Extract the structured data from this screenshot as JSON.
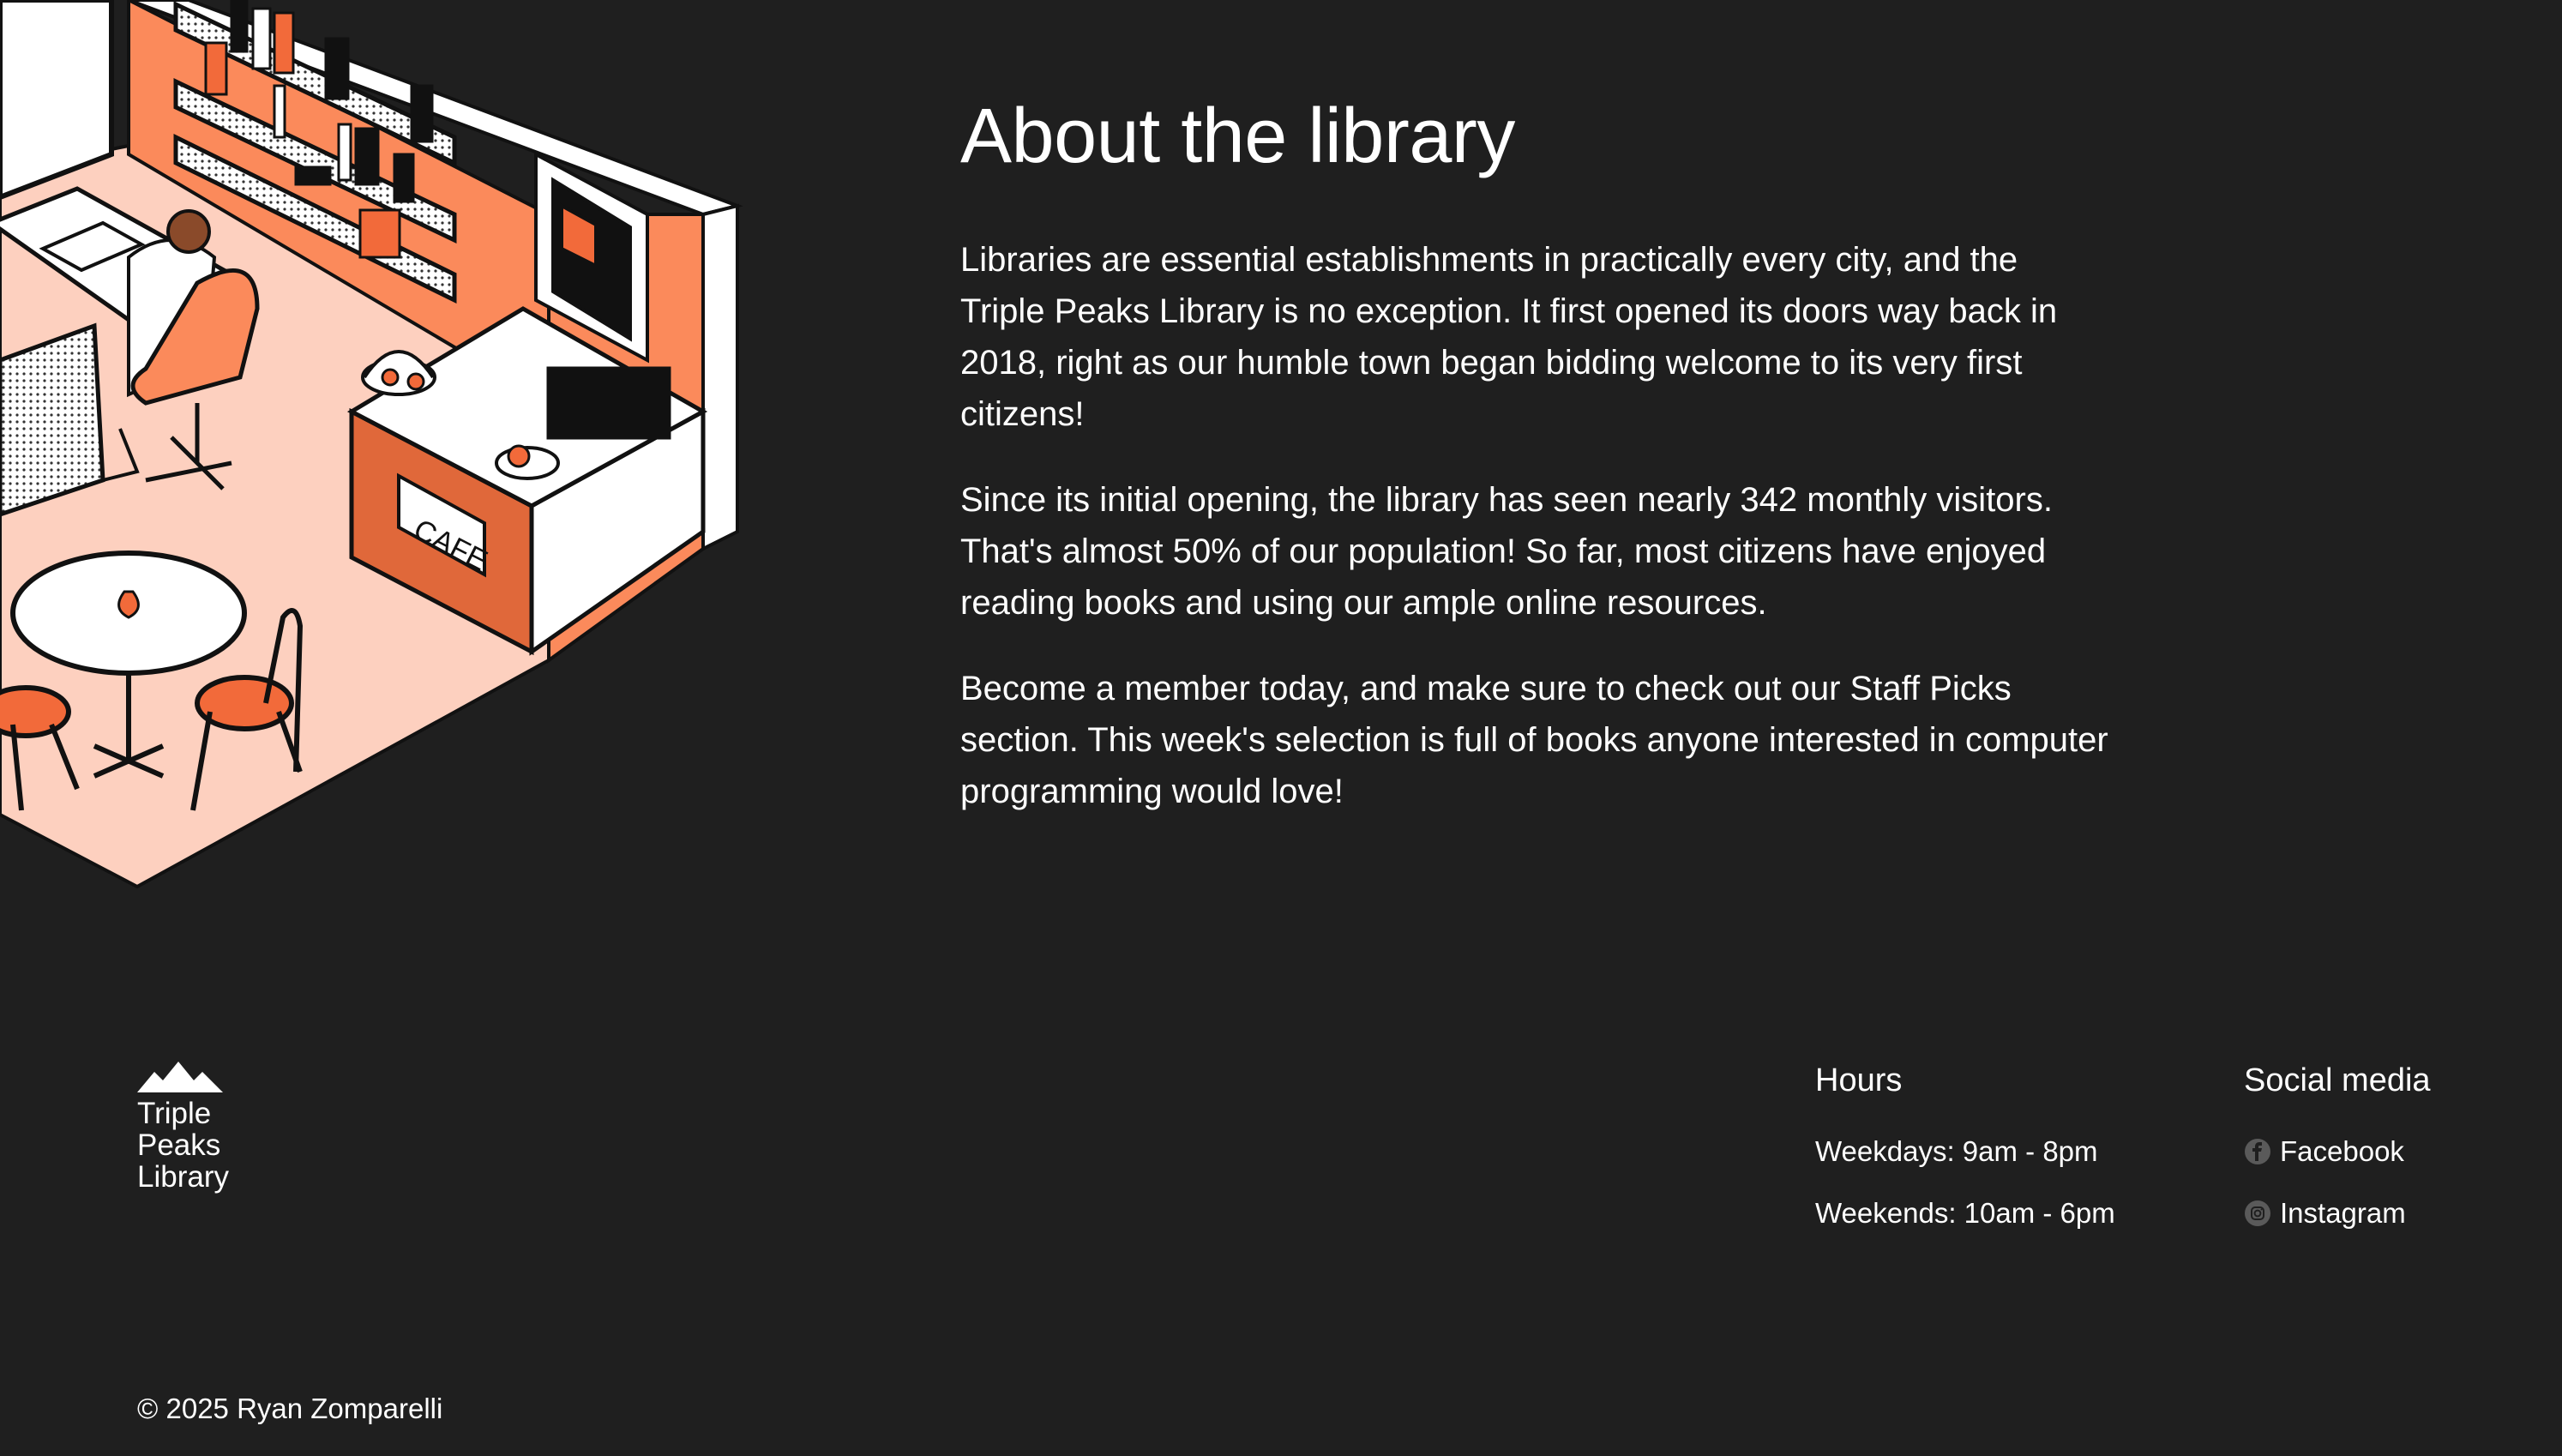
{
  "about": {
    "title": "About the library",
    "paragraphs": [
      "Libraries are essential establishments in practically every city, and the Triple Peaks Library is no exception. It first opened its doors way back in 2018, right as our humble town began bidding welcome to its very first citizens!",
      "Since its initial opening, the library has seen nearly 342 monthly visitors. That's almost 50% of our population! So far, most citizens have enjoyed reading books and using our ample online resources.",
      "Become a member today, and make sure to check out our Staff Picks section. This week's selection is full of books anyone interested in computer programming would love!"
    ]
  },
  "illustration": {
    "cafe_sign": "CAFE",
    "icon": "isometric-library-cafe-illustration"
  },
  "brand": {
    "logo_icon": "mountain-peaks-icon",
    "name_lines": [
      "Triple",
      "Peaks",
      "Library"
    ]
  },
  "footer": {
    "hours": {
      "title": "Hours",
      "weekdays": "Weekdays: 9am - 8pm",
      "weekends": "Weekends: 10am - 6pm"
    },
    "social": {
      "title": "Social media",
      "links": [
        {
          "label": "Facebook",
          "icon": "facebook-icon"
        },
        {
          "label": "Instagram",
          "icon": "instagram-icon"
        }
      ]
    },
    "copyright": "© 2025 Ryan Zomparelli"
  },
  "colors": {
    "background": "#1f1f1f",
    "text": "#ffffff",
    "accent_orange": "#f26a3a",
    "light_orange": "#fb8a5b",
    "floor_peach": "#fdd0bf",
    "icon_grey": "#5a5a5a"
  }
}
